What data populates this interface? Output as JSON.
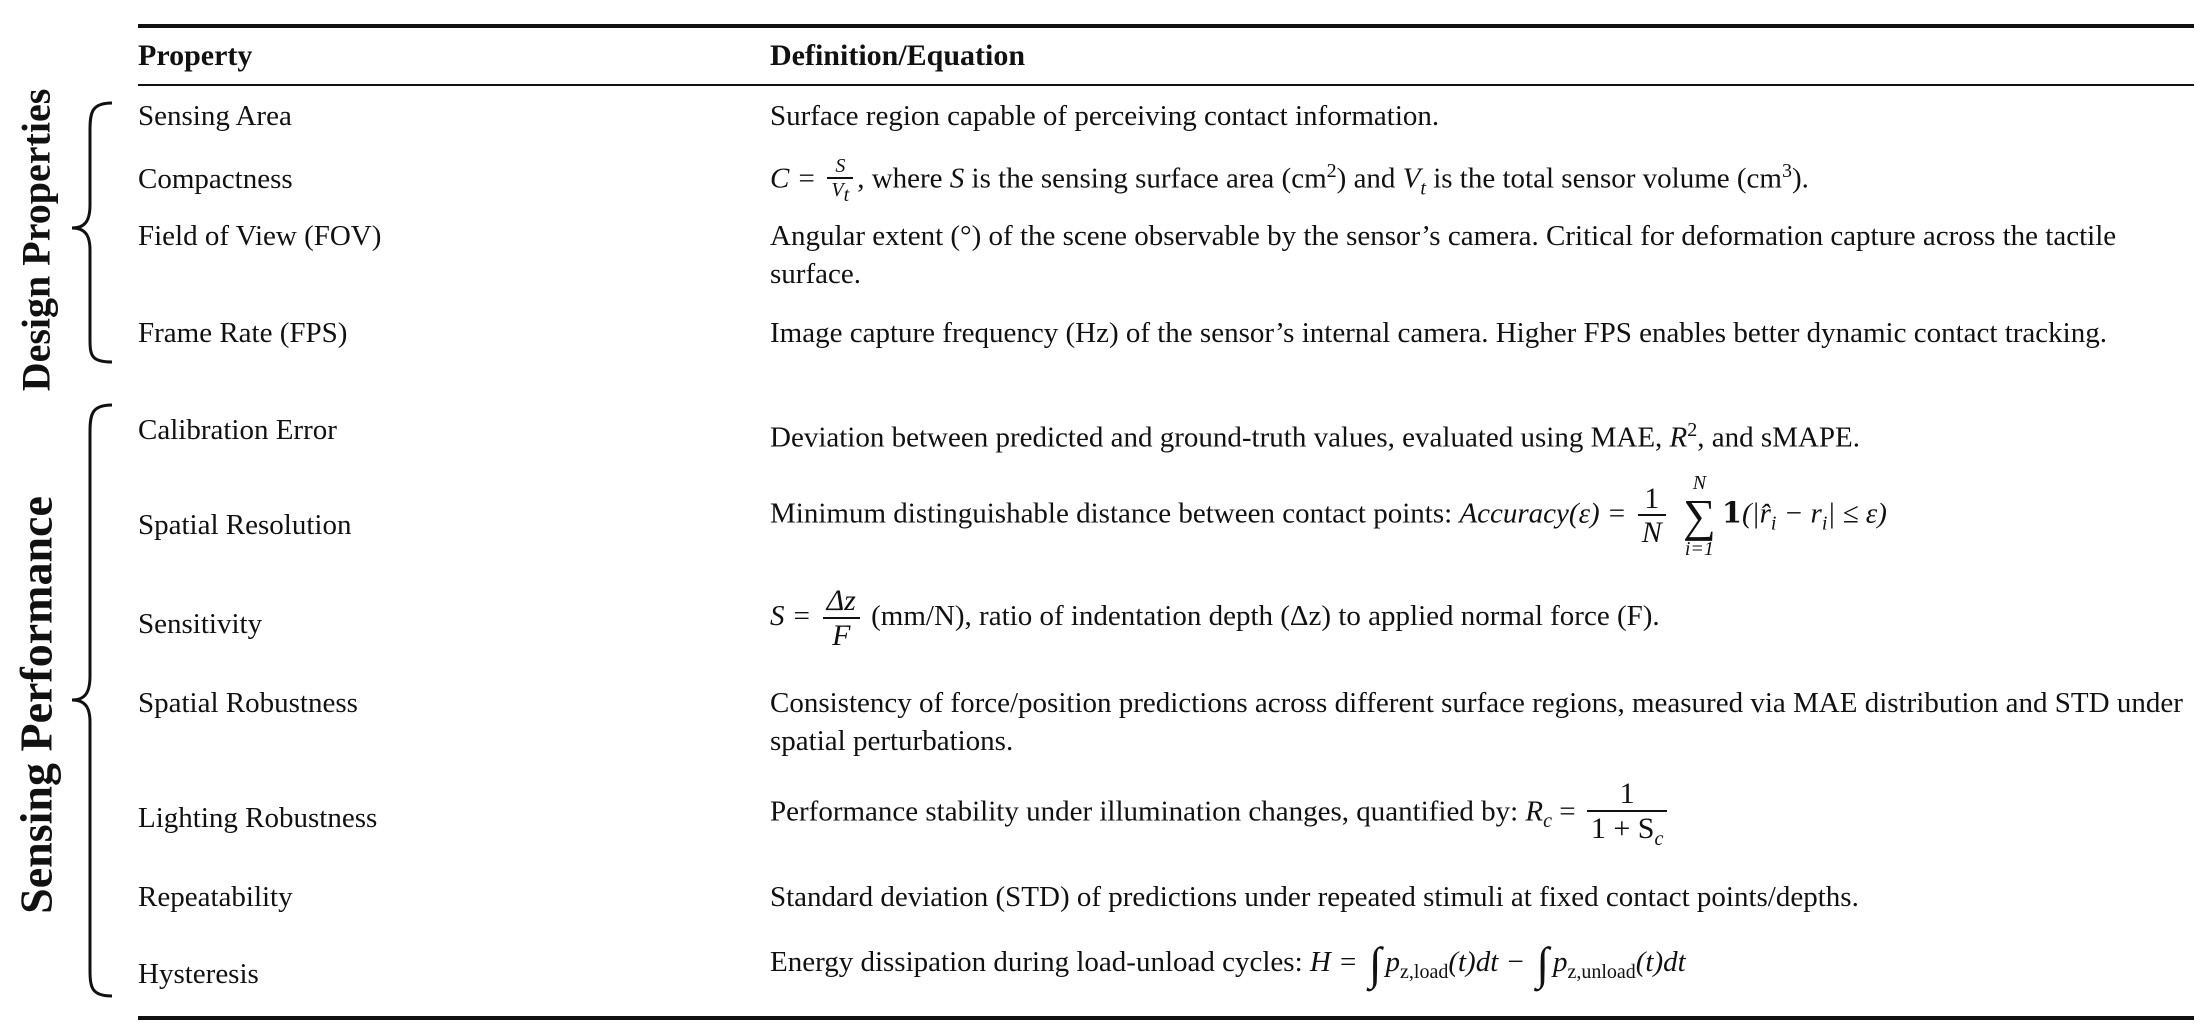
{
  "header": {
    "property": "Property",
    "definition": "Definition/Equation"
  },
  "groups": {
    "design": "Design Properties",
    "sensing": "Sensing Performance"
  },
  "rows": [
    {
      "property": "Sensing Area",
      "definition": "Surface region capable of perceiving contact information."
    },
    {
      "property": "Compactness",
      "def_parts": {
        "lhs": "C =",
        "num": "S",
        "den": "V",
        "den_sub": "t",
        "text1": ", where ",
        "s": "S",
        "text2": " is the sensing surface area (cm",
        "sup1": "2",
        "text3": ") and ",
        "v": "V",
        "v_sub": "t",
        "text4": " is the total sensor volume (cm",
        "sup2": "3",
        "text5": ")."
      }
    },
    {
      "property": "Field of View (FOV)",
      "definition": "Angular extent (°) of the scene observable by the sensor’s camera. Critical for deformation capture across the tactile surface."
    },
    {
      "property": "Frame Rate (FPS)",
      "definition": "Image capture frequency (Hz) of the sensor’s internal camera. Higher FPS enables better dynamic contact tracking."
    },
    {
      "property": "Calibration Error",
      "def_parts": {
        "text1": "Deviation between predicted and ground-truth values, evaluated using MAE, ",
        "r": "R",
        "sup": "2",
        "text2": ", and sMAPE."
      }
    },
    {
      "property": "Spatial Resolution",
      "def_parts": {
        "text1": "Minimum distinguishable distance between contact points: ",
        "acc": "Accuracy(ε) =",
        "num": "1",
        "den": "N",
        "sum_top": "N",
        "sum_bot": "i=1",
        "sigma": "∑",
        "indicator": "𝟏",
        "expr": "(|r̂",
        "i1": "i",
        "minus": " − r",
        "i2": "i",
        "tail": "| ≤ ε)"
      }
    },
    {
      "property": "Sensitivity",
      "def_parts": {
        "lhs": "S =",
        "num": "Δz",
        "den": "F",
        "text1": " (mm/N), ratio of indentation depth (Δz) to applied normal force (F)."
      }
    },
    {
      "property": "Spatial Robustness",
      "definition": "Consistency of force/position predictions across different surface regions, measured via MAE distribution and STD under spatial perturbations."
    },
    {
      "property": "Lighting Robustness",
      "def_parts": {
        "text1": "Performance stability under illumination changes, quantified by: ",
        "r": "R",
        "r_sub": "c",
        "eq": " =",
        "num": "1",
        "den": "1 + S",
        "den_sub": "c"
      }
    },
    {
      "property": "Repeatability",
      "definition": "Standard deviation (STD) of predictions under repeated stimuli at fixed contact points/depths."
    },
    {
      "property": "Hysteresis",
      "def_parts": {
        "text1": "Energy dissipation during load-unload cycles: ",
        "h": "H =",
        "int": "∫",
        "p1": "p",
        "p1_sub": "z,load",
        "t1": "(t)dt − ",
        "p2": "p",
        "p2_sub": "z,unload",
        "t2": "(t)dt"
      }
    }
  ]
}
